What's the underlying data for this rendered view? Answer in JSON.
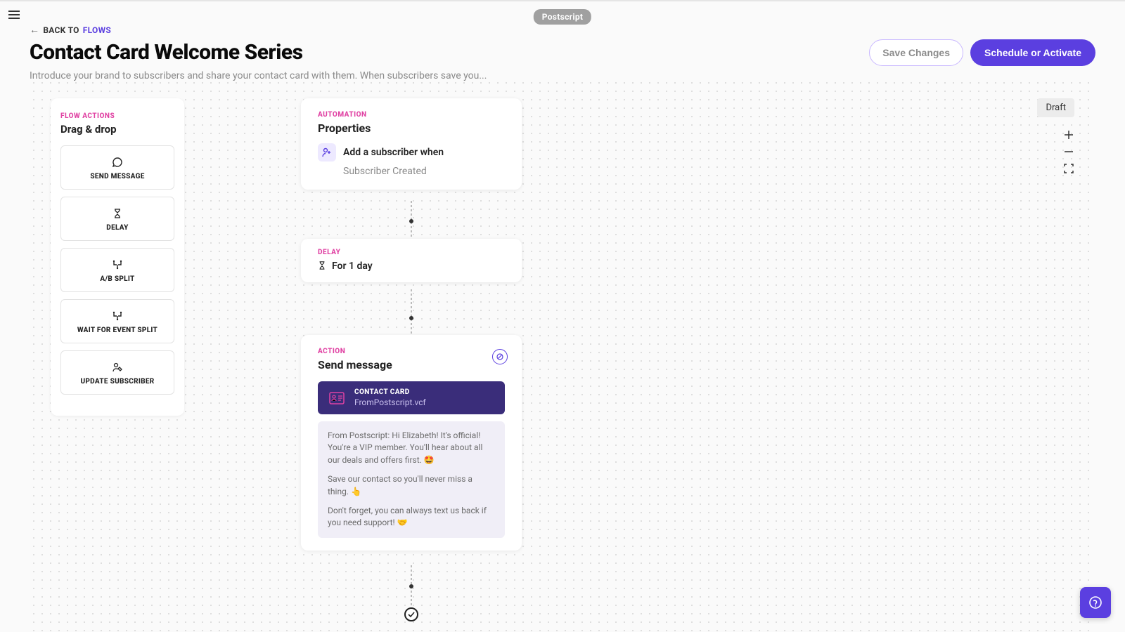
{
  "brand": "Postscript",
  "back": {
    "prefix": "BACK TO",
    "target": "FLOWS"
  },
  "title": "Contact Card Welcome Series",
  "description": "Introduce your brand to subscribers and share your contact card with them. When subscribers save you...",
  "buttons": {
    "save": "Save Changes",
    "schedule": "Schedule or Activate"
  },
  "status_badge": "Draft",
  "sidebar": {
    "label": "FLOW ACTIONS",
    "title": "Drag & drop",
    "items": [
      {
        "label": "SEND MESSAGE",
        "icon": "message-icon"
      },
      {
        "label": "DELAY",
        "icon": "hourglass-icon"
      },
      {
        "label": "A/B SPLIT",
        "icon": "split-icon"
      },
      {
        "label": "WAIT FOR EVENT SPLIT",
        "icon": "split-icon"
      },
      {
        "label": "UPDATE SUBSCRIBER",
        "icon": "person-edit-icon"
      }
    ]
  },
  "nodes": {
    "automation": {
      "label": "AUTOMATION",
      "title": "Properties",
      "trigger_text": "Add a subscriber when",
      "trigger_value": "Subscriber Created"
    },
    "delay": {
      "label": "DELAY",
      "text": "For 1 day"
    },
    "action": {
      "label": "ACTION",
      "title": "Send message",
      "contact_card": {
        "label": "CONTACT CARD",
        "file": "FromPostscript.vcf"
      },
      "message": {
        "p1": "From Postscript: Hi Elizabeth! It's official! You're a VIP member. You'll hear about all our deals and offers first. 🤩",
        "p2": "Save our contact so you'll never miss a thing. 👆",
        "p3": "Don't forget, you can always text us back if you need support! 🤝"
      }
    }
  },
  "colors": {
    "accent": "#5b3fe0",
    "pink": "#e042a3",
    "card_bg": "#3a2d7a"
  }
}
